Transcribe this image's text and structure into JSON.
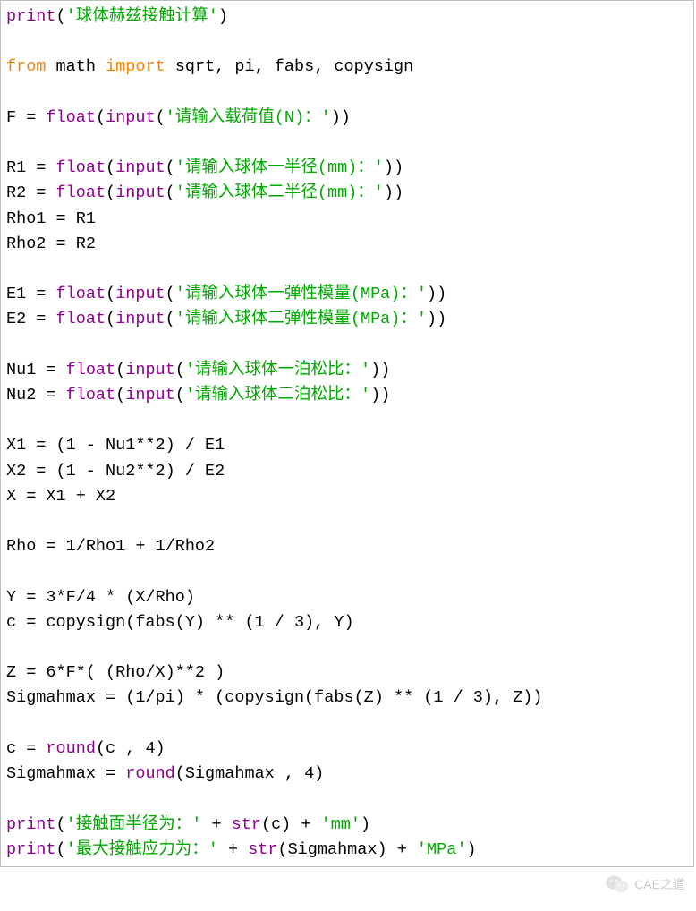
{
  "code": {
    "l1": {
      "fn": "print",
      "p1": "(",
      "s": "'球体赫兹接触计算'",
      "p2": ")"
    },
    "blank": "",
    "l3": {
      "kw1": "from",
      "m": " math ",
      "kw2": "import",
      "rest": " sqrt, pi, fabs, copysign"
    },
    "l5": {
      "pre": "F = ",
      "fn": "float",
      "p1": "(",
      "fn2": "input",
      "p2": "(",
      "s": "'请输入载荷值(N)：'",
      "p3": "))"
    },
    "l7": {
      "pre": "R1 = ",
      "fn": "float",
      "p1": "(",
      "fn2": "input",
      "p2": "(",
      "s": "'请输入球体一半径(mm)：'",
      "p3": "))"
    },
    "l8": {
      "pre": "R2 = ",
      "fn": "float",
      "p1": "(",
      "fn2": "input",
      "p2": "(",
      "s": "'请输入球体二半径(mm)：'",
      "p3": "))"
    },
    "l9": "Rho1 = R1",
    "l10": "Rho2 = R2",
    "l12": {
      "pre": "E1 = ",
      "fn": "float",
      "p1": "(",
      "fn2": "input",
      "p2": "(",
      "s": "'请输入球体一弹性模量(MPa)：'",
      "p3": "))"
    },
    "l13": {
      "pre": "E2 = ",
      "fn": "float",
      "p1": "(",
      "fn2": "input",
      "p2": "(",
      "s": "'请输入球体二弹性模量(MPa)：'",
      "p3": "))"
    },
    "l15": {
      "pre": "Nu1 = ",
      "fn": "float",
      "p1": "(",
      "fn2": "input",
      "p2": "(",
      "s": "'请输入球体一泊松比：'",
      "p3": "))"
    },
    "l16": {
      "pre": "Nu2 = ",
      "fn": "float",
      "p1": "(",
      "fn2": "input",
      "p2": "(",
      "s": "'请输入球体二泊松比：'",
      "p3": "))"
    },
    "l18": "X1 = (1 - Nu1**2) / E1",
    "l19": "X2 = (1 - Nu2**2) / E2",
    "l20": "X = X1 + X2",
    "l22": "Rho = 1/Rho1 + 1/Rho2",
    "l24": "Y = 3*F/4 * (X/Rho)",
    "l25": "c = copysign(fabs(Y) ** (1 / 3), Y)",
    "l27": "Z = 6*F*( (Rho/X)**2 )",
    "l28": "Sigmahmax = (1/pi) * (copysign(fabs(Z) ** (1 / 3), Z))",
    "l30": {
      "pre": "c = ",
      "fn": "round",
      "rest": "(c , 4)"
    },
    "l31": {
      "pre": "Sigmahmax = ",
      "fn": "round",
      "rest": "(Sigmahmax , 4)"
    },
    "l33": {
      "fn": "print",
      "p1": "(",
      "s1": "'接触面半径为：'",
      "mid": " + ",
      "fn2": "str",
      "p2": "(c) + ",
      "s2": "'mm'",
      "p3": ")"
    },
    "l34": {
      "fn": "print",
      "p1": "(",
      "s1": "'最大接触应力为：'",
      "mid": " + ",
      "fn2": "str",
      "p2": "(Sigmahmax) + ",
      "s2": "'MPa'",
      "p3": ")"
    }
  },
  "watermark": {
    "text": "CAE之道"
  }
}
